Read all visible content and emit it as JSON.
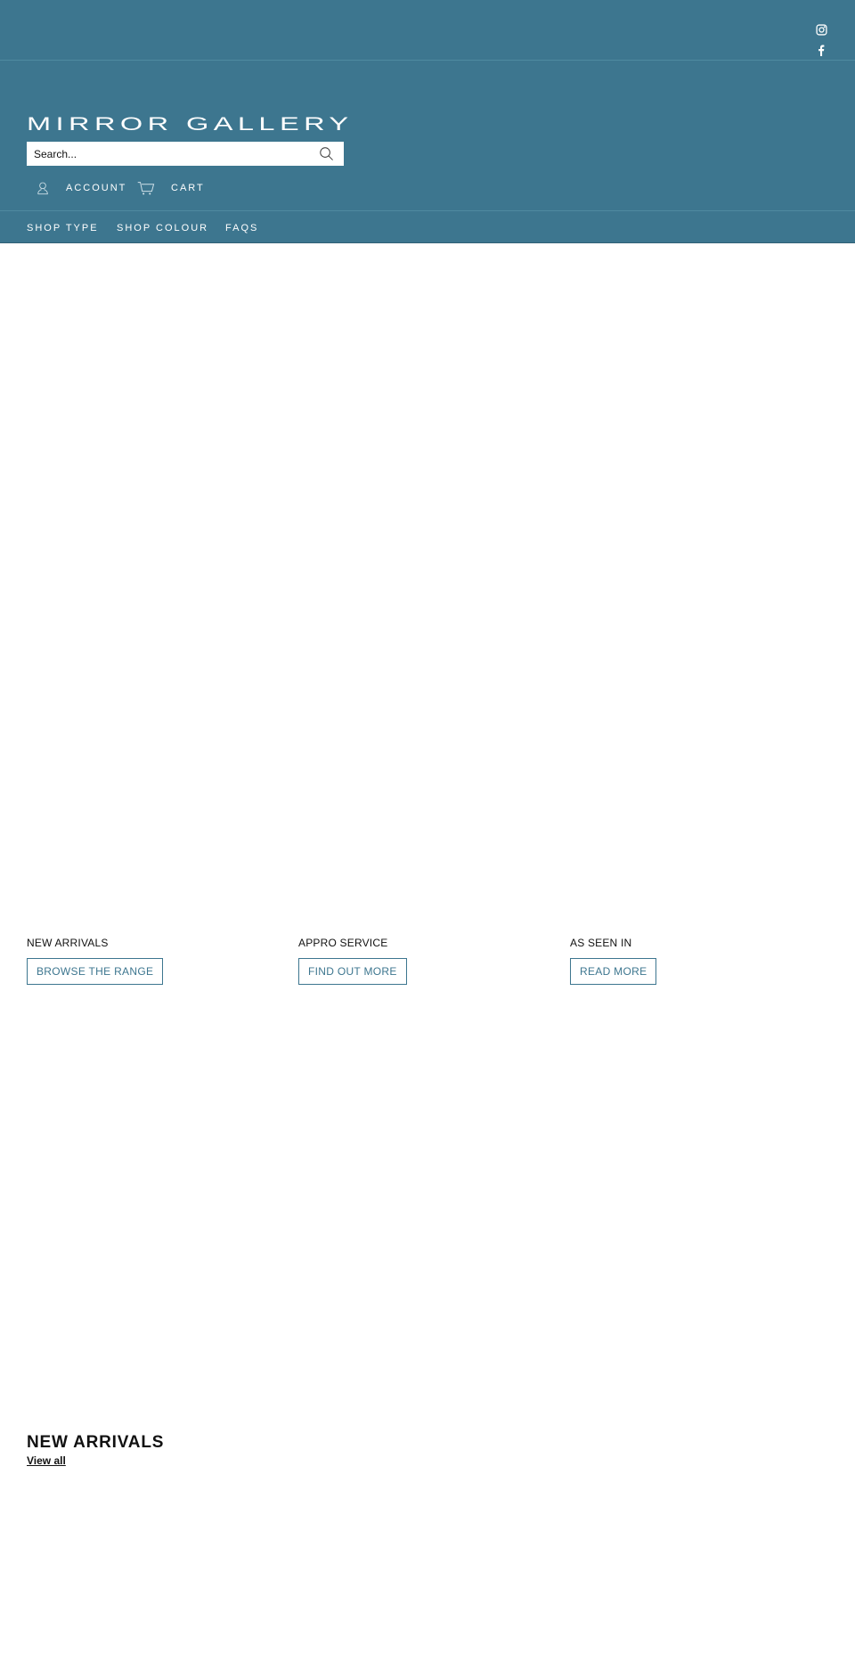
{
  "brand": {
    "name": "MIRROR GALLERY",
    "accent_color": "#3d768f"
  },
  "social": [
    {
      "name": "Instagram",
      "icon": "instagram-icon"
    },
    {
      "name": "Facebook",
      "icon": "facebook-icon"
    }
  ],
  "search": {
    "placeholder": "Search...",
    "value": "",
    "icon": "search-icon"
  },
  "utility": {
    "account_label": "ACCOUNT",
    "cart_label": "CART"
  },
  "nav": {
    "items": [
      {
        "label": "SHOP TYPE"
      },
      {
        "label": "SHOP COLOUR"
      },
      {
        "label": "FAQS"
      }
    ]
  },
  "promos": [
    {
      "title": "NEW ARRIVALS",
      "button": "BROWSE THE RANGE"
    },
    {
      "title": "APPRO SERVICE",
      "button": "FIND OUT MORE"
    },
    {
      "title": "AS SEEN IN",
      "button": "READ MORE"
    }
  ],
  "new_arrivals": {
    "title": "NEW ARRIVALS",
    "link": "View all"
  }
}
